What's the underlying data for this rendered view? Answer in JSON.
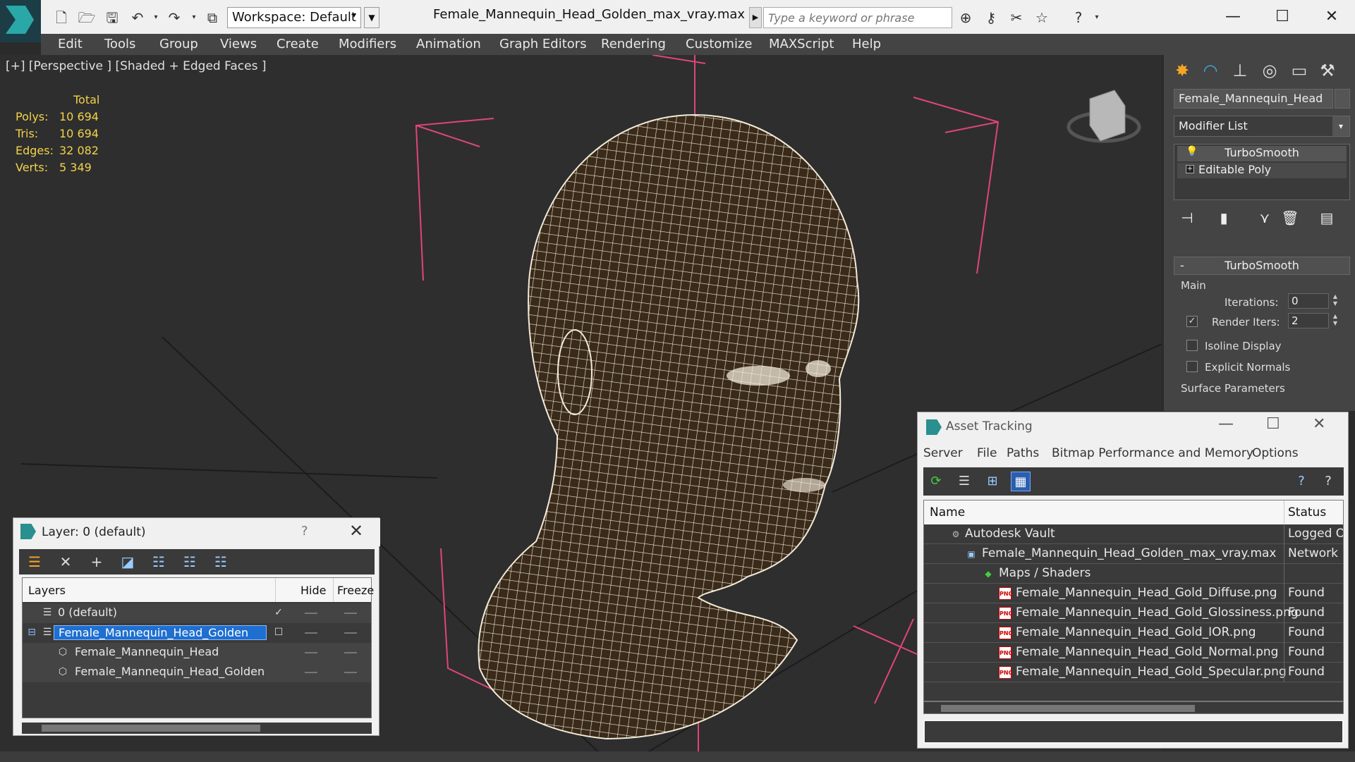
{
  "window": {
    "title": "Female_Mannequin_Head_Golden_max_vray.max",
    "workspace": "Workspace: Default",
    "search_placeholder": "Type a keyword or phrase"
  },
  "menu": [
    "Edit",
    "Tools",
    "Group",
    "Views",
    "Create",
    "Modifiers",
    "Animation",
    "Graph Editors",
    "Rendering",
    "Customize",
    "MAXScript",
    "Help"
  ],
  "viewport": {
    "label": "[+] [Perspective ] [Shaded + Edged Faces ]",
    "stats": {
      "header": "Total",
      "rows": [
        {
          "k": "Polys:",
          "v": "10 694"
        },
        {
          "k": "Tris:",
          "v": "10 694"
        },
        {
          "k": "Edges:",
          "v": "32 082"
        },
        {
          "k": "Verts:",
          "v": "5 349"
        }
      ]
    }
  },
  "command_panel": {
    "object_name": "Female_Mannequin_Head",
    "modifier_list": "Modifier List",
    "stack": [
      "TurboSmooth",
      "Editable Poly"
    ],
    "turbosmooth": {
      "title": "TurboSmooth",
      "main_label": "Main",
      "iterations_label": "Iterations:",
      "iterations_value": "0",
      "render_iters_label": "Render Iters:",
      "render_iters_value": "2",
      "isoline": "Isoline Display",
      "explicit_normals": "Explicit Normals",
      "surface_params": "Surface Parameters"
    }
  },
  "layer_window": {
    "title": "Layer: 0 (default)",
    "help": "?",
    "columns": {
      "layers": "Layers",
      "hide": "Hide",
      "freeze": "Freeze"
    },
    "rows": [
      {
        "name": "0 (default)"
      },
      {
        "name": "Female_Mannequin_Head_Golden"
      },
      {
        "name": "Female_Mannequin_Head"
      },
      {
        "name": "Female_Mannequin_Head_Golden"
      }
    ]
  },
  "asset_window": {
    "title": "Asset Tracking",
    "menu": [
      "Server",
      "File",
      "Paths",
      "Bitmap Performance and Memory",
      "Options"
    ],
    "columns": {
      "name": "Name",
      "status": "Status"
    },
    "rows": [
      {
        "name": "Autodesk Vault",
        "status": "Logged Out"
      },
      {
        "name": "Female_Mannequin_Head_Golden_max_vray.max",
        "status": "Network Path"
      },
      {
        "name": "Maps / Shaders",
        "status": ""
      },
      {
        "name": "Female_Mannequin_Head_Gold_Diffuse.png",
        "status": "Found"
      },
      {
        "name": "Female_Mannequin_Head_Gold_Glossiness.png",
        "status": "Found"
      },
      {
        "name": "Female_Mannequin_Head_Gold_IOR.png",
        "status": "Found"
      },
      {
        "name": "Female_Mannequin_Head_Gold_Normal.png",
        "status": "Found"
      },
      {
        "name": "Female_Mannequin_Head_Gold_Specular.png",
        "status": "Found"
      }
    ]
  },
  "colors": {
    "stats_yellow": "#f3d24a",
    "selection_blue": "#1e6fd0",
    "bbox_pink": "#e0457a",
    "wire_white": "#f2ead8",
    "mesh_fill": "#3a2a1a"
  }
}
